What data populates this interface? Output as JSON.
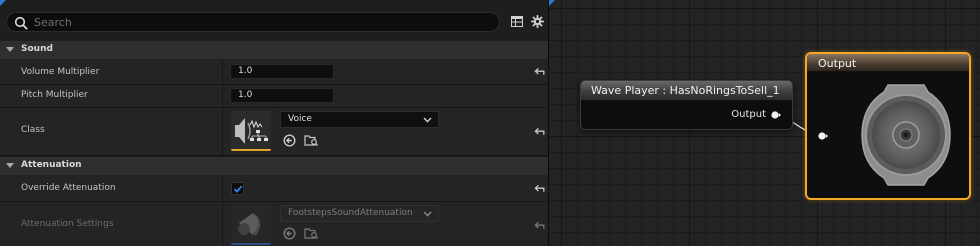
{
  "details": {
    "search_placeholder": "Search",
    "categories": {
      "sound": "Sound",
      "attenuation": "Attenuation"
    },
    "properties": {
      "volume_multiplier": {
        "label": "Volume Multiplier",
        "value": "1.0"
      },
      "pitch_multiplier": {
        "label": "Pitch Multiplier",
        "value": "1.0"
      },
      "class": {
        "label": "Class",
        "value": "Voice"
      },
      "override_attenuation": {
        "label": "Override Attenuation",
        "checked": true
      },
      "attenuation_settings": {
        "label": "Attenuation Settings",
        "value": "FootstepsSoundAttenuation"
      }
    }
  },
  "graph": {
    "wave_player_node": {
      "title": "Wave Player : HasNoRingsToSell_1",
      "output_pin": "Output"
    },
    "output_node": {
      "title": "Output"
    }
  },
  "colors": {
    "accent_blue": "#2e7bd6",
    "selection_orange": "#f5a623",
    "class_bar": "#e3a62a",
    "attenuation_bar": "#3a6fd6",
    "checkbox_check": "#3b82f6"
  },
  "icons": [
    "search-icon",
    "table-icon",
    "gear-icon",
    "reset-arrow-icon",
    "browse-arrow-icon",
    "folder-search-icon",
    "chevron-down-icon",
    "speaker-icon",
    "checkmark-icon",
    "sound-class-icon"
  ]
}
